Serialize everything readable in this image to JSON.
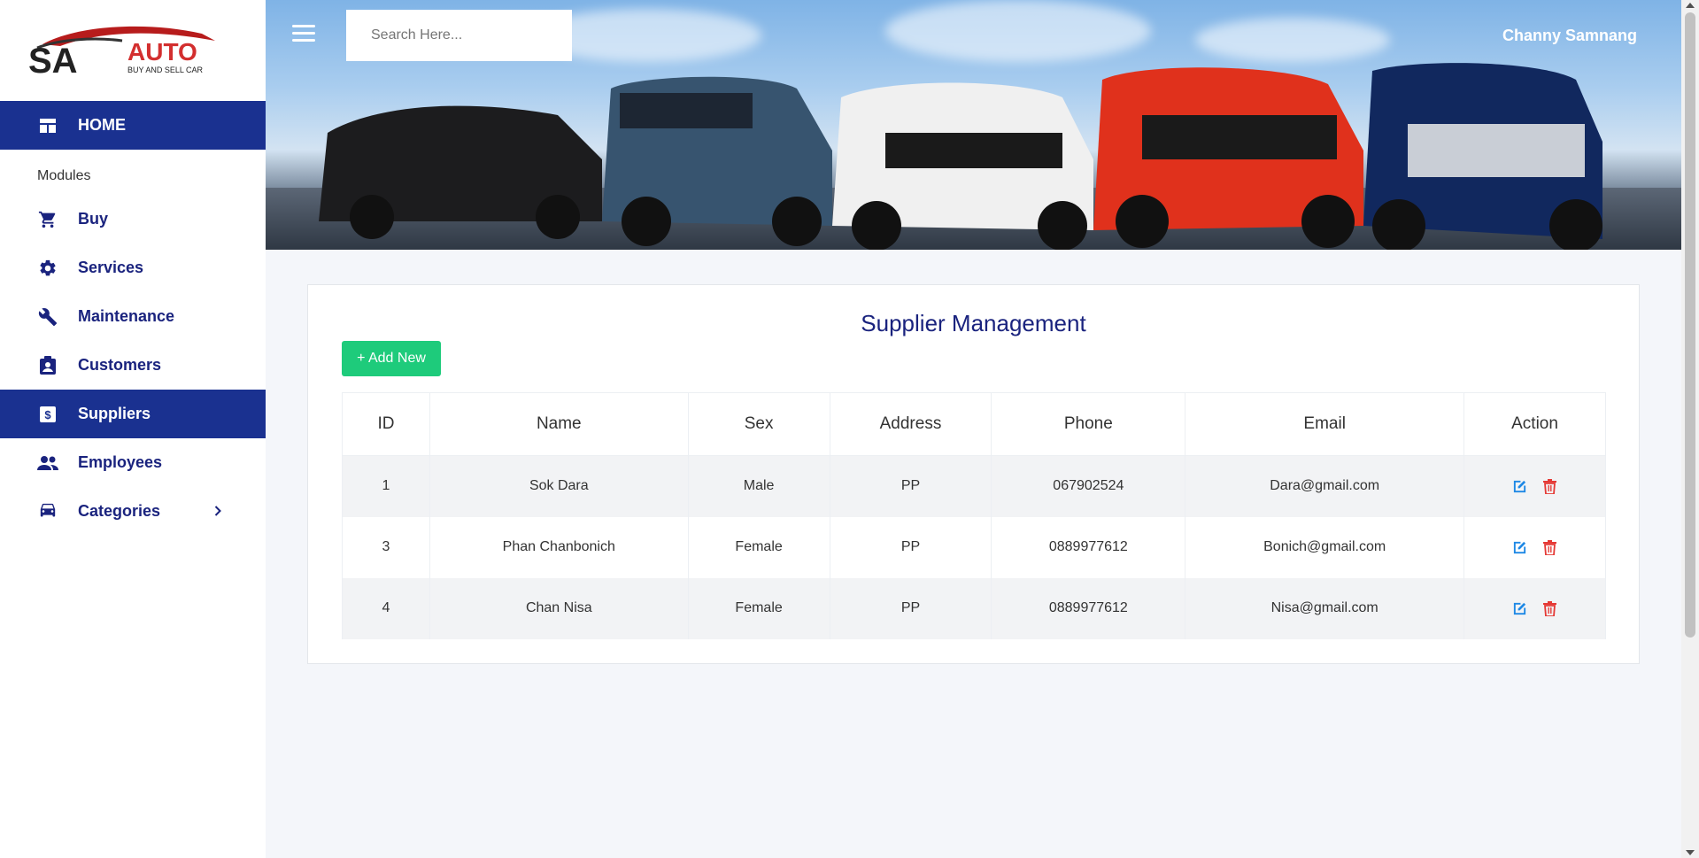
{
  "brand": {
    "logo_text": "AUTO",
    "logo_mark": "SA",
    "tagline": "BUY AND SELL CAR",
    "color_primary": "#1a237e",
    "color_logo_red": "#d32f2f"
  },
  "sidebar": {
    "home_label": "HOME",
    "modules_label": "Modules",
    "items": [
      {
        "label": "Buy",
        "icon": "cart-icon"
      },
      {
        "label": "Services",
        "icon": "gear-icon"
      },
      {
        "label": "Maintenance",
        "icon": "wrench-icon"
      },
      {
        "label": "Customers",
        "icon": "contact-card-icon"
      },
      {
        "label": "Suppliers",
        "icon": "supplier-dollar-icon",
        "active": true
      },
      {
        "label": "Employees",
        "icon": "people-icon"
      },
      {
        "label": "Categories",
        "icon": "car-icon"
      }
    ],
    "active_color": "#1a3190"
  },
  "header": {
    "search_placeholder": "Search Here...",
    "user_name": "Channy Samnang"
  },
  "main": {
    "title": "Supplier Management",
    "add_button": "+ Add New",
    "add_button_color": "#1ecb7b",
    "columns": [
      "ID",
      "Name",
      "Sex",
      "Address",
      "Phone",
      "Email",
      "Action"
    ],
    "rows": [
      {
        "id": "1",
        "name": "Sok Dara",
        "sex": "Male",
        "address": "PP",
        "phone": "067902524",
        "email": "Dara@gmail.com"
      },
      {
        "id": "3",
        "name": "Phan Chanbonich",
        "sex": "Female",
        "address": "PP",
        "phone": "0889977612",
        "email": "Bonich@gmail.com"
      },
      {
        "id": "4",
        "name": "Chan Nisa",
        "sex": "Female",
        "address": "PP",
        "phone": "0889977612",
        "email": "Nisa@gmail.com"
      }
    ],
    "edit_icon_color": "#1e88e5",
    "delete_icon_color": "#e53935"
  }
}
